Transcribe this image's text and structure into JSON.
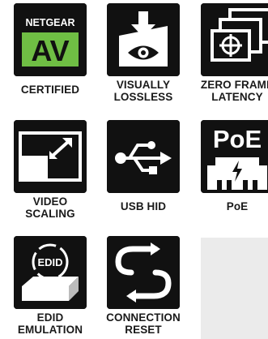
{
  "features": [
    {
      "id": "certified",
      "icon": "netgear-av-logo-icon",
      "badge_brand": "NETGEAR",
      "badge_mark": "AV",
      "lines": [
        "CERTIFIED"
      ]
    },
    {
      "id": "visually-lossless",
      "icon": "eye-download-icon",
      "lines": [
        "VISUALLY",
        "LOSSLESS"
      ]
    },
    {
      "id": "zero-frame-latency",
      "icon": "stacked-frames-crosshair-icon",
      "lines": [
        "ZERO FRAME",
        "LATENCY"
      ]
    },
    {
      "id": "video-scaling",
      "icon": "scaling-arrow-icon",
      "lines": [
        "VIDEO",
        "SCALING"
      ]
    },
    {
      "id": "usb-hid",
      "icon": "usb-icon",
      "lines": [
        "USB HID"
      ]
    },
    {
      "id": "poe",
      "icon": "poe-port-icon",
      "badge_mark": "PoE",
      "lines": [
        "PoE"
      ]
    },
    {
      "id": "edid-emulation",
      "icon": "edid-box-icon",
      "badge_mark": "EDID",
      "lines": [
        "EDID",
        "EMULATION"
      ]
    },
    {
      "id": "connection-reset",
      "icon": "connection-reset-icon",
      "lines": [
        "CONNECTION",
        "RESET"
      ]
    }
  ],
  "colors": {
    "tile_bg": "#111111",
    "accent_green": "#6fbe44",
    "tile_fg": "#ffffff",
    "caption": "#1a1a1a",
    "empty_panel": "#ebebeb"
  }
}
